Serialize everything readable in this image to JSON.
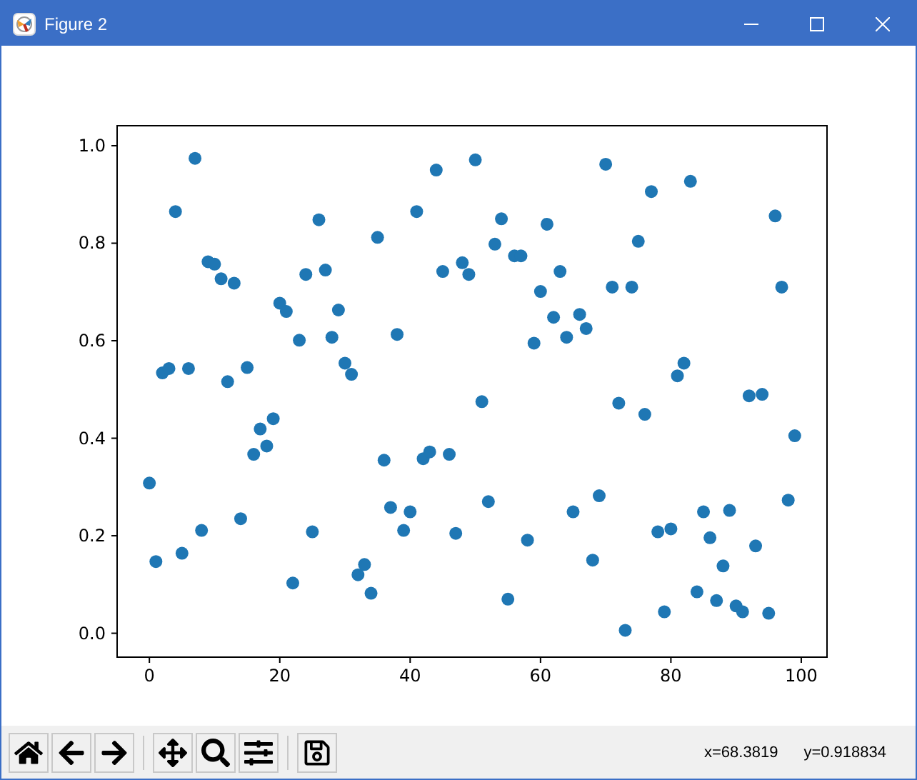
{
  "window": {
    "title": "Figure 2"
  },
  "figure": {
    "chart_data": {
      "type": "scatter",
      "xlim": [
        -4.95,
        103.95
      ],
      "ylim": [
        -0.049,
        1.041
      ],
      "xticks": [
        0,
        20,
        40,
        60,
        80,
        100
      ],
      "yticks": [
        {
          "value": 0,
          "label": "0.0"
        },
        {
          "value": 0.2,
          "label": "0.2"
        },
        {
          "value": 0.4,
          "label": "0.4"
        },
        {
          "value": 0.6,
          "label": "0.6"
        },
        {
          "value": 0.8,
          "label": "0.8"
        },
        {
          "value": 1,
          "label": "1.0"
        }
      ],
      "x": [
        0,
        1,
        2,
        3,
        4,
        5,
        6,
        7,
        8,
        9,
        10,
        11,
        12,
        13,
        14,
        15,
        16,
        17,
        18,
        19,
        20,
        21,
        22,
        23,
        24,
        25,
        26,
        27,
        28,
        29,
        30,
        31,
        32,
        33,
        34,
        35,
        36,
        37,
        38,
        39,
        40,
        41,
        42,
        43,
        44,
        45,
        46,
        47,
        48,
        49,
        50,
        51,
        52,
        53,
        54,
        55,
        56,
        57,
        58,
        59,
        60,
        61,
        62,
        63,
        64,
        65,
        66,
        67,
        68,
        69,
        70,
        71,
        72,
        73,
        74,
        75,
        76,
        77,
        78,
        79,
        80,
        81,
        82,
        83,
        84,
        85,
        86,
        87,
        88,
        89,
        90,
        91,
        92,
        93,
        94,
        95,
        96,
        97,
        98,
        99
      ],
      "series": [
        {
          "color": "#1f77b4",
          "values": [
            0.308,
            0.147,
            0.534,
            0.543,
            0.865,
            0.164,
            0.543,
            0.974,
            0.211,
            0.762,
            0.757,
            0.727,
            0.516,
            0.718,
            0.235,
            0.545,
            0.367,
            0.419,
            0.384,
            0.44,
            0.677,
            0.66,
            0.103,
            0.601,
            0.736,
            0.208,
            0.848,
            0.745,
            0.607,
            0.663,
            0.554,
            0.531,
            0.12,
            0.141,
            0.082,
            0.812,
            0.355,
            0.258,
            0.613,
            0.211,
            0.249,
            0.865,
            0.358,
            0.372,
            0.95,
            0.742,
            0.367,
            0.205,
            0.76,
            0.736,
            0.971,
            0.475,
            0.27,
            0.798,
            0.85,
            0.07,
            0.774,
            0.774,
            0.191,
            0.595,
            0.701,
            0.839,
            0.648,
            0.742,
            0.607,
            0.249,
            0.654,
            0.625,
            0.15,
            0.282,
            0.962,
            0.71,
            0.472,
            0.006,
            0.71,
            0.804,
            0.449,
            0.906,
            0.208,
            0.044,
            0.214,
            0.528,
            0.554,
            0.927,
            0.085,
            0.249,
            0.196,
            0.067,
            0.138,
            0.252,
            0.056,
            0.044,
            0.487,
            0.179,
            0.49,
            0.041,
            0.856,
            0.71,
            0.273,
            0.405
          ]
        }
      ]
    }
  },
  "toolbar": {
    "buttons": [
      {
        "kind": "home"
      },
      {
        "kind": "back"
      },
      {
        "kind": "forward"
      },
      {
        "kind": "separator"
      },
      {
        "kind": "pan"
      },
      {
        "kind": "zoom"
      },
      {
        "kind": "configure"
      },
      {
        "kind": "separator"
      },
      {
        "kind": "save"
      }
    ]
  },
  "status": {
    "x_reading": "x=68.3819",
    "y_reading": "y=0.918834"
  }
}
